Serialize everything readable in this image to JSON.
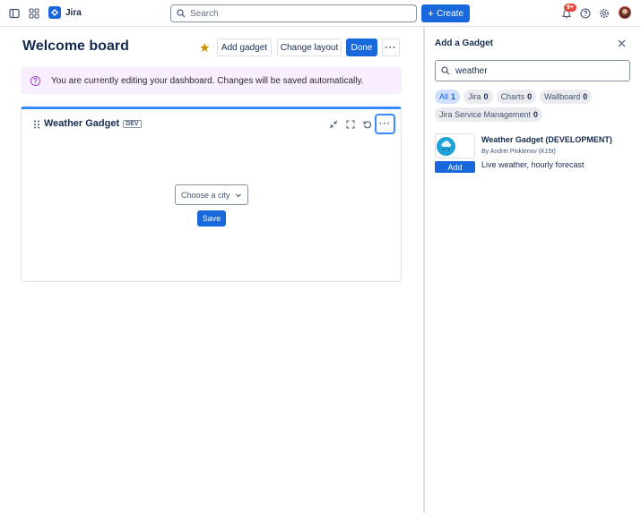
{
  "topbar": {
    "app_name": "Jira",
    "search_placeholder": "Search",
    "create_label": "Create",
    "notification_count": "9+"
  },
  "main": {
    "title": "Welcome board",
    "add_gadget_label": "Add gadget",
    "change_layout_label": "Change layout",
    "done_label": "Done",
    "banner_text": "You are currently editing your dashboard. Changes will be saved automatically."
  },
  "gadget": {
    "title": "Weather Gadget",
    "badge": "DEV",
    "city_placeholder": "Choose a city",
    "save_label": "Save"
  },
  "panel": {
    "title": "Add a Gadget",
    "search_value": "weather",
    "filters": [
      {
        "label": "All",
        "count": "1",
        "selected": true
      },
      {
        "label": "Jira",
        "count": "0",
        "selected": false
      },
      {
        "label": "Charts",
        "count": "0",
        "selected": false
      },
      {
        "label": "Wallboard",
        "count": "0",
        "selected": false
      },
      {
        "label": "Jira Service Management",
        "count": "0",
        "selected": false
      }
    ],
    "result": {
      "name": "Weather Gadget (DEVELOPMENT)",
      "author": "By Andrei Pisklenov (K15t)",
      "description": "Live weather, hourly forecast",
      "add_label": "Add"
    }
  },
  "colors": {
    "brand": "#1868db",
    "banner_bg": "#f8eefe",
    "star": "#c99000",
    "badge": "#e2483d"
  }
}
